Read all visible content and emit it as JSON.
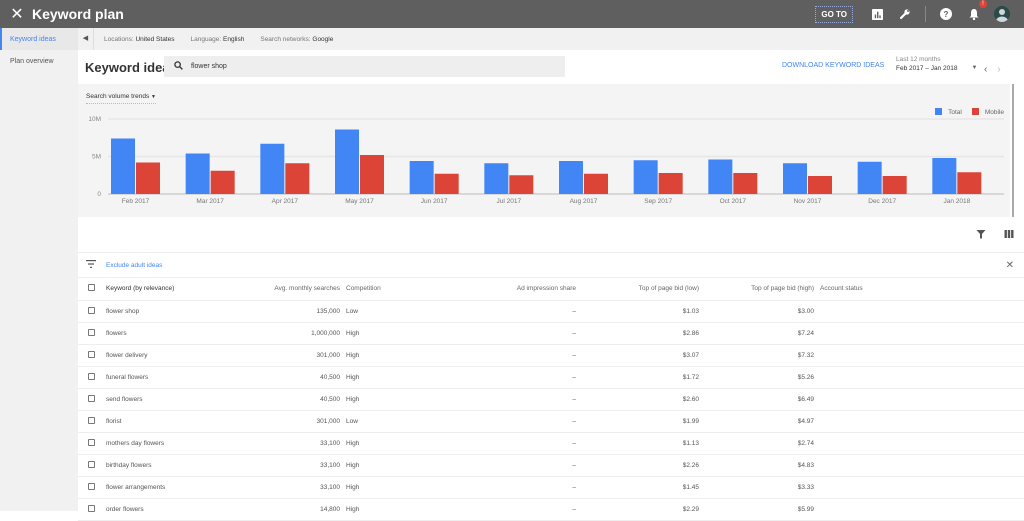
{
  "topbar": {
    "title": "Keyword plan",
    "goto_label": "GO TO",
    "notification_count": "!"
  },
  "sidebar": {
    "items": [
      {
        "label": "Keyword ideas",
        "active": true
      },
      {
        "label": "Plan overview",
        "active": false
      }
    ]
  },
  "filters": {
    "locations_label": "Locations:",
    "locations_value": "United States",
    "language_label": "Language:",
    "language_value": "English",
    "networks_label": "Search networks:",
    "networks_value": "Google"
  },
  "header": {
    "title": "Keyword ideas",
    "search_value": "flower shop",
    "download_label": "DOWNLOAD KEYWORD IDEAS",
    "date_label": "Last 12 months",
    "date_value": "Feb 2017 – Jan 2018"
  },
  "chart_panel": {
    "dropdown_label": "Search volume trends"
  },
  "chart_data": {
    "type": "bar",
    "title": "Search volume trends",
    "categories": [
      "Feb 2017",
      "Mar 2017",
      "Apr 2017",
      "May 2017",
      "Jun 2017",
      "Jul 2017",
      "Aug 2017",
      "Sep 2017",
      "Oct 2017",
      "Nov 2017",
      "Dec 2017",
      "Jan 2018"
    ],
    "series": [
      {
        "name": "Total",
        "color": "#4285f4",
        "values": [
          7.4,
          5.4,
          6.7,
          8.6,
          4.4,
          4.1,
          4.4,
          4.5,
          4.6,
          4.1,
          4.3,
          4.8
        ]
      },
      {
        "name": "Mobile",
        "color": "#db4437",
        "values": [
          4.2,
          3.1,
          4.1,
          5.2,
          2.7,
          2.5,
          2.7,
          2.8,
          2.8,
          2.4,
          2.4,
          2.9
        ]
      }
    ],
    "units": "millions",
    "ylim": [
      0,
      10
    ],
    "yticks": [
      "0",
      "5M",
      "10M"
    ],
    "grid": true,
    "legend": "top-right"
  },
  "table_tools": {
    "exclude_label": "Exclude adult ideas"
  },
  "table": {
    "columns": [
      "Keyword (by relevance)",
      "Avg. monthly searches",
      "Competition",
      "Ad impression share",
      "Top of page bid (low)",
      "Top of page bid (high)",
      "Account status"
    ],
    "rows": [
      {
        "keyword": "flower shop",
        "searches": "135,000",
        "competition": "Low",
        "share": "–",
        "low": "$1.03",
        "high": "$3.00"
      },
      {
        "keyword": "flowers",
        "searches": "1,000,000",
        "competition": "High",
        "share": "–",
        "low": "$2.86",
        "high": "$7.24"
      },
      {
        "keyword": "flower delivery",
        "searches": "301,000",
        "competition": "High",
        "share": "–",
        "low": "$3.07",
        "high": "$7.32"
      },
      {
        "keyword": "funeral flowers",
        "searches": "40,500",
        "competition": "High",
        "share": "–",
        "low": "$1.72",
        "high": "$5.26"
      },
      {
        "keyword": "send flowers",
        "searches": "40,500",
        "competition": "High",
        "share": "–",
        "low": "$2.60",
        "high": "$6.49"
      },
      {
        "keyword": "florist",
        "searches": "301,000",
        "competition": "Low",
        "share": "–",
        "low": "$1.99",
        "high": "$4.97"
      },
      {
        "keyword": "mothers day flowers",
        "searches": "33,100",
        "competition": "High",
        "share": "–",
        "low": "$1.13",
        "high": "$2.74"
      },
      {
        "keyword": "birthday flowers",
        "searches": "33,100",
        "competition": "High",
        "share": "–",
        "low": "$2.26",
        "high": "$4.83"
      },
      {
        "keyword": "flower arrangements",
        "searches": "33,100",
        "competition": "High",
        "share": "–",
        "low": "$1.45",
        "high": "$3.33"
      },
      {
        "keyword": "order flowers",
        "searches": "14,800",
        "competition": "High",
        "share": "–",
        "low": "$2.29",
        "high": "$5.99"
      }
    ]
  }
}
